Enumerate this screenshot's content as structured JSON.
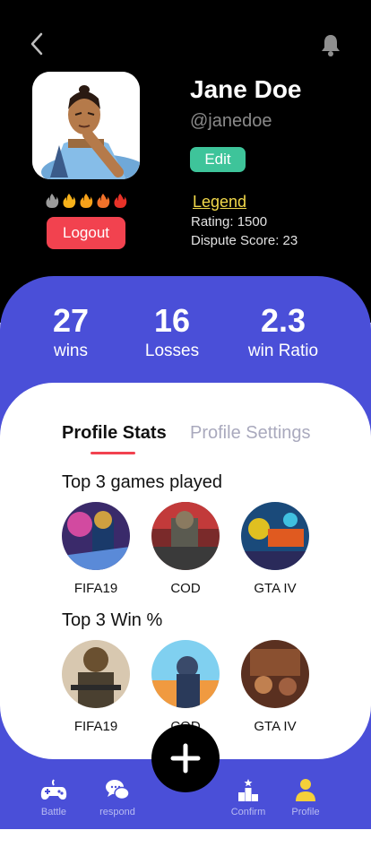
{
  "header": {
    "back_icon": "chevron-left-icon",
    "notifications_icon": "bell-icon"
  },
  "profile": {
    "name": "Jane Doe",
    "handle": "@janedoe",
    "edit_label": "Edit",
    "logout_label": "Logout",
    "rank": "Legend",
    "rating": "Rating: 1500",
    "dispute_score": "Dispute Score: 23",
    "streak_flames": [
      "#9c9c9c",
      "#f7b21a",
      "#f7a21a",
      "#f2722a",
      "#e83228"
    ]
  },
  "stats": [
    {
      "value": "27",
      "label": "wins"
    },
    {
      "value": "16",
      "label": "Losses"
    },
    {
      "value": "2.3",
      "label": "win Ratio"
    }
  ],
  "tabs": {
    "active": "Profile Stats",
    "inactive": "Profile Settings"
  },
  "sections": {
    "played_title": "Top 3 games played",
    "win_title": "Top 3 Win %"
  },
  "games_played": [
    {
      "name": "FIFA19"
    },
    {
      "name": "COD"
    },
    {
      "name": "GTA IV"
    }
  ],
  "games_win": [
    {
      "name": "FIFA19"
    },
    {
      "name": "COD"
    },
    {
      "name": "GTA IV"
    }
  ],
  "bottom_nav": [
    {
      "label": "Battle",
      "icon": "gamepad-icon"
    },
    {
      "label": "respond",
      "icon": "chat-bubbles-icon"
    },
    {
      "label": "Confirm",
      "icon": "podium-icon"
    },
    {
      "label": "Profile",
      "icon": "person-icon"
    }
  ],
  "fab_icon": "plus-icon",
  "colors": {
    "accent_blue": "#4a4fd8",
    "edit_green": "#3ec49a",
    "logout_red": "#f2424f",
    "rank_gold": "#f2d94a"
  }
}
